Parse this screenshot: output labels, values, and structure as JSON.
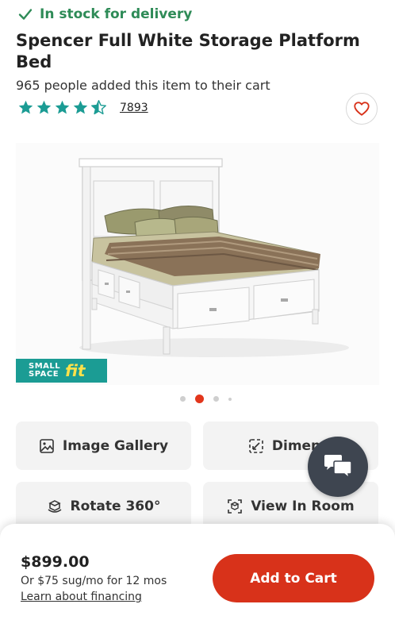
{
  "stock": {
    "icon": "check-icon",
    "text": "In stock for delivery",
    "color": "#2e8b57"
  },
  "product": {
    "title": "Spencer Full White Storage Platform Bed",
    "added_to_cart": "965 people added this item to their cart",
    "rating": 4.5,
    "review_count": "7893"
  },
  "favorite": {
    "icon": "heart-icon"
  },
  "hero": {
    "badge_small_line1": "SMALL",
    "badge_small_line2": "SPACE",
    "badge_fit": "fit",
    "carousel": {
      "total": 4,
      "active": 2
    }
  },
  "actions": [
    {
      "label": "Image Gallery",
      "icon": "image-icon"
    },
    {
      "label": "Dimensi",
      "icon": "dimensions-icon"
    },
    {
      "label": "Rotate 360°",
      "icon": "rotate-360-icon"
    },
    {
      "label": "View In Room",
      "icon": "view-in-room-icon"
    }
  ],
  "chat": {
    "icon": "chat-icon"
  },
  "purchase": {
    "price": "$899.00",
    "financing": "Or $75 sug/mo for 12 mos",
    "learn_link": "Learn about financing",
    "add_to_cart": "Add to Cart"
  },
  "colors": {
    "accent": "#d8321a",
    "teal": "#1b9c94",
    "stock_green": "#2e8b57"
  }
}
